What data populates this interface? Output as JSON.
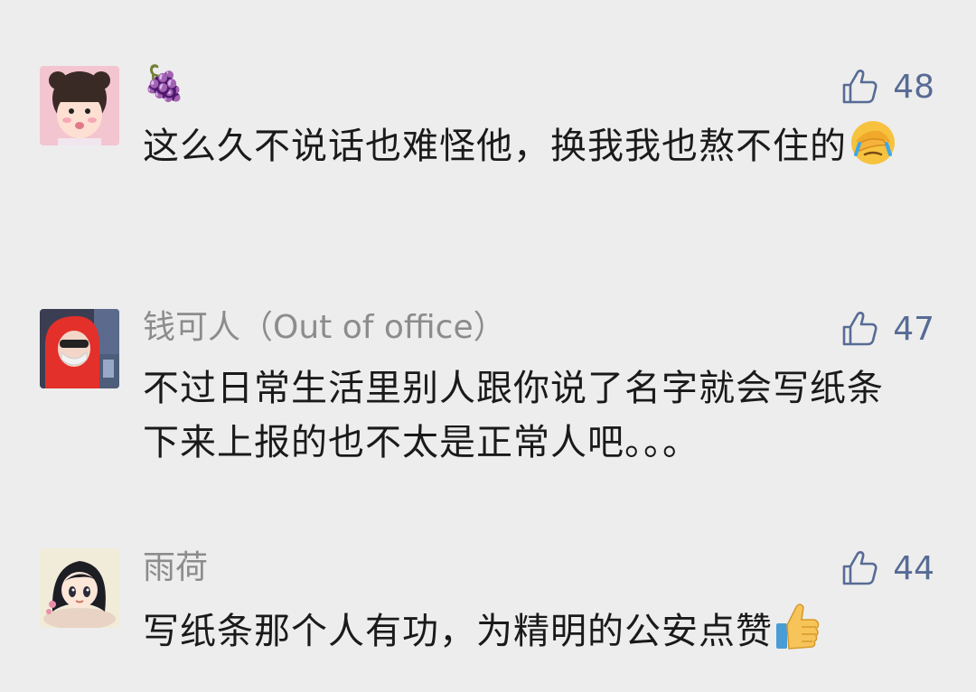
{
  "comments": [
    {
      "author": "🍇",
      "likes": "48",
      "text": "这么久不说话也难怪他，换我我也熬不住的",
      "text_emoji": "facepalm-emoji",
      "avatar": "girl-avatar"
    },
    {
      "author": "钱可人（Out of office）",
      "likes": "47",
      "text": "不过日常生活里别人跟你说了名字就会写纸条下来上报的也不太是正常人吧。。。",
      "avatar": "red-hood-mask-avatar"
    },
    {
      "author": "雨荷",
      "likes": "44",
      "text": "写纸条那个人有功，为精明的公安点赞",
      "text_emoji": "thumbs-up-emoji",
      "avatar": "cartoon-girl-avatar"
    }
  ],
  "colors": {
    "background": "#ededed",
    "author": "#8c8c8c",
    "likes": "#576b95",
    "text": "#1a1a1a"
  },
  "icons": {
    "like": "thumbs-up-outline-icon"
  }
}
